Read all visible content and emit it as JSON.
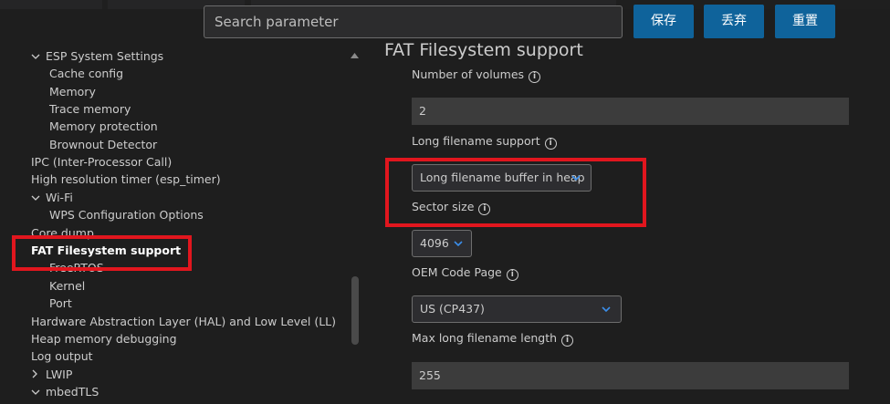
{
  "search": {
    "placeholder": "Search parameter"
  },
  "toolbar": {
    "save_label": "保存",
    "discard_label": "丢弃",
    "reset_label": "重置"
  },
  "tree": {
    "items": [
      {
        "label": "ESP System Settings",
        "expanded": true
      },
      {
        "label": "Cache config"
      },
      {
        "label": "Memory"
      },
      {
        "label": "Trace memory"
      },
      {
        "label": "Memory protection"
      },
      {
        "label": "Brownout Detector"
      },
      {
        "label": "IPC (Inter-Processor Call)"
      },
      {
        "label": "High resolution timer (esp_timer)"
      },
      {
        "label": "Wi-Fi",
        "expanded": true
      },
      {
        "label": "WPS Configuration Options"
      },
      {
        "label": "Core dump"
      },
      {
        "label": "FAT Filesystem support",
        "selected": true
      },
      {
        "label": "FreeRTOS"
      },
      {
        "label": "Kernel"
      },
      {
        "label": "Port"
      },
      {
        "label": "Hardware Abstraction Layer (HAL) and Low Level (LL)"
      },
      {
        "label": "Heap memory debugging"
      },
      {
        "label": "Log output"
      },
      {
        "label": "LWIP",
        "expanded": false
      },
      {
        "label": "mbedTLS",
        "expanded": true
      }
    ]
  },
  "section": {
    "title": "FAT Filesystem support",
    "number_of_volumes": {
      "label": "Number of volumes",
      "value": "2"
    },
    "long_filename_support": {
      "label": "Long filename support",
      "value": "Long filename buffer in heap"
    },
    "sector_size": {
      "label": "Sector size",
      "value": "4096"
    },
    "oem_code_page": {
      "label": "OEM Code Page",
      "value": "US (CP437)"
    },
    "max_long_filename_length": {
      "label": "Max long filename length",
      "value": "255"
    }
  },
  "colors": {
    "accent": "#0f639b",
    "highlight": "#e1161e",
    "background": "#1e1e1e",
    "input_bg": "#3c3c3c"
  }
}
